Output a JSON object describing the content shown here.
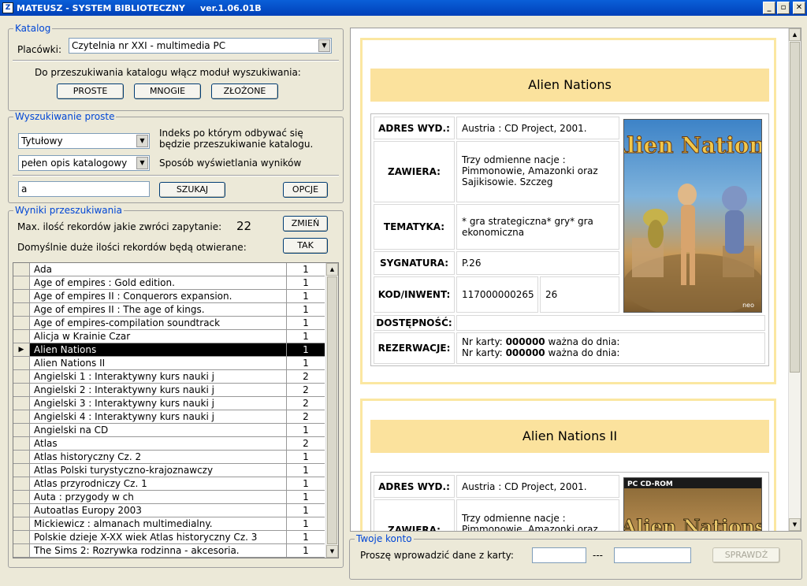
{
  "window": {
    "title": "MATEUSZ - SYSTEM BIBLIOTECZNY     ver.1.06.01B",
    "min": "_",
    "max": "▫",
    "close": "✕"
  },
  "katalog": {
    "legend": "Katalog",
    "placowki_label": "Placówki:",
    "placowki_value": "Czytelnia nr XXI - multimedia PC",
    "hint": "Do przeszukiwania katalogu włącz moduł wyszukiwania:",
    "btn_proste": "PROSTE",
    "btn_mnogie": "MNOGIE",
    "btn_zlozone": "ZŁOŻONE"
  },
  "search": {
    "legend": "Wyszukiwanie proste",
    "index_value": "Tytułowy",
    "index_desc1": "Indeks po którym odbywać się",
    "index_desc2": "będzie przeszukiwanie katalogu.",
    "display_value": "pełen opis katalogowy",
    "display_desc": "Sposób wyświetlania wyników",
    "query": "a",
    "btn_search": "SZUKAJ",
    "btn_options": "OPCJE"
  },
  "results": {
    "legend": "Wyniki przeszukiwania",
    "max_label": "Max. ilość rekordów jakie zwróci zapytanie:",
    "max_value": "22",
    "btn_change": "ZMIEŃ",
    "default_label": "Domyślnie duże ilości rekordów będą otwierane:",
    "btn_yes": "TAK",
    "selected_marker": "▶",
    "rows": [
      {
        "title": "Ada",
        "count": "1"
      },
      {
        "title": "Age of empires : Gold edition.",
        "count": "1"
      },
      {
        "title": "Age of empires II : Conquerors expansion.",
        "count": "1"
      },
      {
        "title": "Age of empires II : The age of kings.",
        "count": "1"
      },
      {
        "title": "Age of empires-compilation soundtrack",
        "count": "1"
      },
      {
        "title": "Alicja w Krainie Czar",
        "count": "1"
      },
      {
        "title": "Alien Nations",
        "count": "1"
      },
      {
        "title": "Alien Nations II",
        "count": "1"
      },
      {
        "title": "Angielski 1 : Interaktywny kurs nauki j",
        "count": "2"
      },
      {
        "title": "Angielski 2 : Interaktywny kurs nauki j",
        "count": "2"
      },
      {
        "title": "Angielski 3 : Interaktywny kurs nauki j",
        "count": "2"
      },
      {
        "title": "Angielski 4 : Interaktywny kurs nauki j",
        "count": "2"
      },
      {
        "title": "Angielski na CD",
        "count": "1"
      },
      {
        "title": "Atlas",
        "count": "2"
      },
      {
        "title": "Atlas historyczny  Cz. 2",
        "count": "1"
      },
      {
        "title": "Atlas Polski turystyczno-krajoznawczy",
        "count": "1"
      },
      {
        "title": "Atlas przyrodniczy  Cz. 1",
        "count": "1"
      },
      {
        "title": "Auta :  przygody w ch",
        "count": "1"
      },
      {
        "title": "Autoatlas Europy 2003",
        "count": "1"
      },
      {
        "title": "Mickiewicz : almanach multimedialny.",
        "count": "1"
      },
      {
        "title": "Polskie dzieje X-XX wiek Atlas historyczny Cz. 3",
        "count": "1"
      },
      {
        "title": "The Sims 2: Rozrywka rodzinna - akcesoria.",
        "count": "1"
      }
    ]
  },
  "record1": {
    "title": "Alien Nations",
    "adres_k": "ADRES WYD.:",
    "adres_v": "Austria : CD Project, 2001.",
    "zawiera_k": "ZAWIERA:",
    "zawiera_v": "Trzy odmienne nacje : Pimmonowie, Amazonki oraz Sajikisowie. Szczeg",
    "tematyka_k": "TEMATYKA:",
    "tematyka_v": "* gra strategiczna* gry* gra ekonomiczna",
    "sygnatura_k": "SYGNATURA:",
    "sygnatura_v": "P.26",
    "kod_k": "KOD/INWENT:",
    "kod_v": "117000000265",
    "inwent_v": "26",
    "dostepnosc_k": "DOSTĘPNOŚĆ:",
    "rezerwacje_k": "REZERWACJE:",
    "rez_prefix": "Nr karty:",
    "rez_card": "000000",
    "rez_suffix": "ważna do dnia:",
    "cover_text": "Alien Nations",
    "cover_corner": "neo"
  },
  "record2": {
    "title": "Alien Nations II",
    "adres_k": "ADRES WYD.:",
    "adres_v": "Austria : CD Project, 2001.",
    "zawiera_k": "ZAWIERA:",
    "zawiera_v": "Trzy odmienne nacje : Pimmonowie, Amazonki oraz",
    "cover_top": "PC CD-ROM",
    "cover_text": "Alien Nations"
  },
  "konto": {
    "legend": "Twoje konto",
    "label": "Proszę wprowadzić dane z karty:",
    "sep": "---",
    "btn_check": "SPRAWDŹ"
  }
}
